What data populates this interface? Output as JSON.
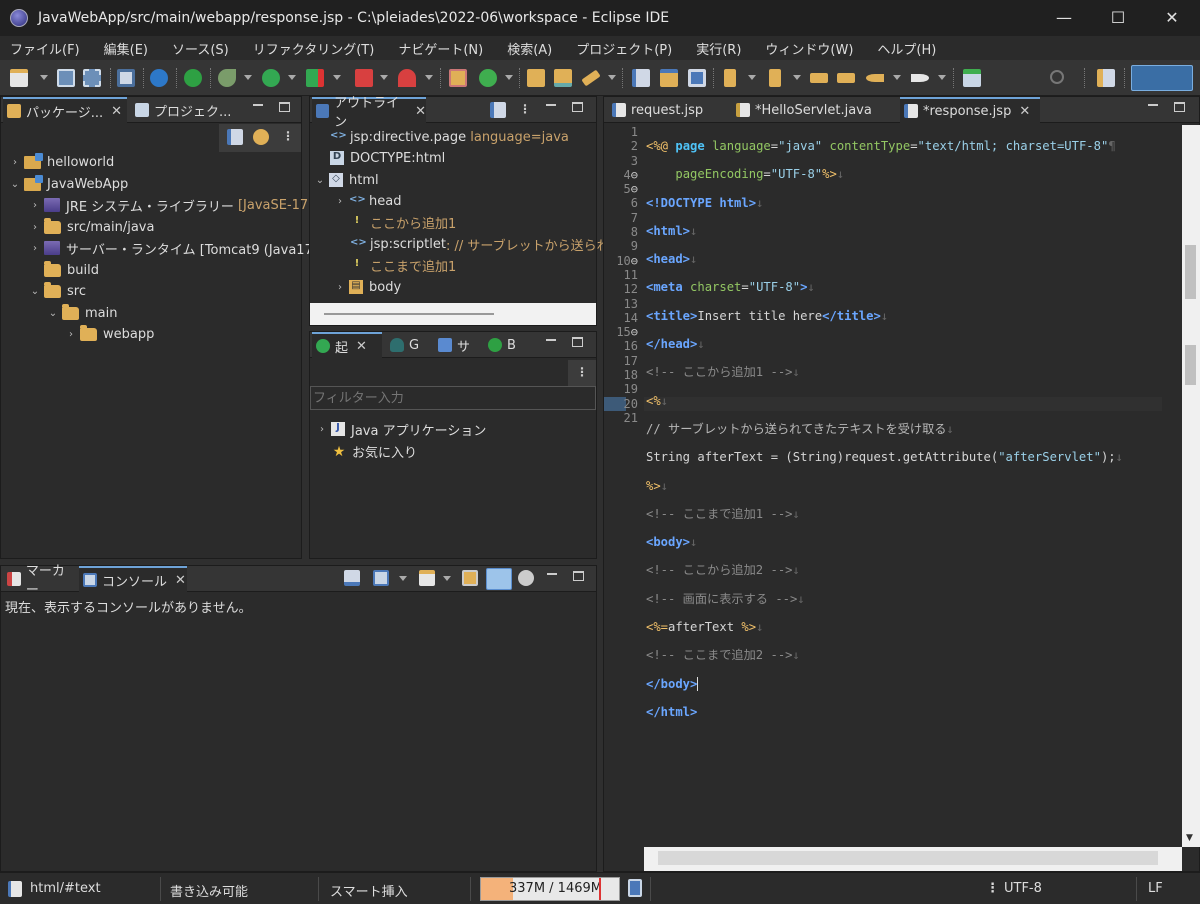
{
  "window": {
    "title": "JavaWebApp/src/main/webapp/response.jsp - C:\\pleiades\\2022-06\\workspace - Eclipse IDE"
  },
  "menu": [
    "ファイル(F)",
    "編集(E)",
    "ソース(S)",
    "リファクタリング(T)",
    "ナビゲート(N)",
    "検索(A)",
    "プロジェクト(P)",
    "実行(R)",
    "ウィンドウ(W)",
    "ヘルプ(H)"
  ],
  "explorer": {
    "tabs": [
      "パッケージ...",
      "プロジェク..."
    ],
    "items": [
      {
        "label": "helloworld",
        "extra": ""
      },
      {
        "label": "JavaWebApp",
        "extra": ""
      },
      {
        "label": "JRE システム・ライブラリー",
        "extra": "[JavaSE-17]"
      },
      {
        "label": "src/main/java",
        "extra": ""
      },
      {
        "label": "サーバー・ランタイム [Tomcat9 (Java17)]",
        "extra": ""
      },
      {
        "label": "build",
        "extra": ""
      },
      {
        "label": "src",
        "extra": ""
      },
      {
        "label": "main",
        "extra": ""
      },
      {
        "label": "webapp",
        "extra": ""
      }
    ]
  },
  "outline": {
    "tab": "アウトライン",
    "items": [
      {
        "label": "jsp:directive.page",
        "extra": "language=java"
      },
      {
        "label": "DOCTYPE:html",
        "extra": ""
      },
      {
        "label": "html",
        "extra": ""
      },
      {
        "label": "head",
        "extra": ""
      },
      {
        "label": "ここから追加1",
        "extra": ""
      },
      {
        "label": "jsp:scriptlet",
        "extra": ": // サーブレットから送られ"
      },
      {
        "label": "ここまで追加1",
        "extra": ""
      },
      {
        "label": "body",
        "extra": ""
      }
    ]
  },
  "launcher": {
    "tabs": [
      "起",
      "G",
      "サ",
      "B"
    ],
    "filter_placeholder": "フィルター入力",
    "items": [
      "Java アプリケーション",
      "お気に入り"
    ]
  },
  "console": {
    "tabs": [
      "マーカー",
      "コンソール"
    ],
    "message": "現在、表示するコンソールがありません。"
  },
  "editor": {
    "tabs": [
      "request.jsp",
      "*HelloServlet.java",
      "*response.jsp"
    ],
    "line_numbers": [
      "1",
      "2",
      "3",
      "4",
      "5",
      "6",
      "7",
      "8",
      "9",
      "10",
      "11",
      "12",
      "13",
      "14",
      "15",
      "16",
      "17",
      "18",
      "19",
      "20",
      "21"
    ]
  },
  "status": {
    "path": "html/#text",
    "writable": "書き込み可能",
    "insert_mode": "スマート挿入",
    "memory": "337M / 1469M",
    "memory_used_fraction": 0.23,
    "encoding": "UTF-8",
    "line_ending": "LF"
  }
}
